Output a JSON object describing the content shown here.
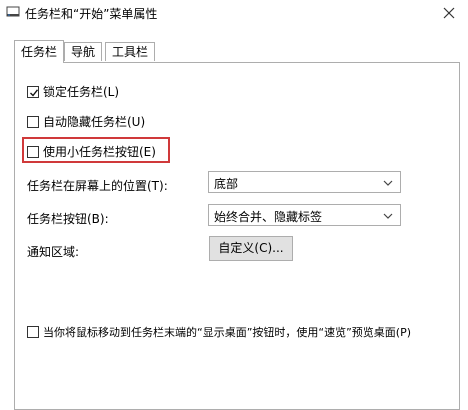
{
  "window": {
    "title": "任务栏和“开始”菜单属性",
    "app_icon": "taskbar-properties-icon",
    "close_icon": "close-icon"
  },
  "tabs": [
    {
      "label": "任务栏",
      "active": true
    },
    {
      "label": "导航",
      "active": false
    },
    {
      "label": "工具栏",
      "active": false
    }
  ],
  "taskbar": {
    "lock": {
      "label": "锁定任务栏(L)",
      "checked": true
    },
    "autohide": {
      "label": "自动隐藏任务栏(U)",
      "checked": false
    },
    "small_buttons": {
      "label": "使用小任务栏按钮(E)",
      "checked": false
    },
    "location": {
      "label": "任务栏在屏幕上的位置(T):",
      "value": "底部"
    },
    "buttons": {
      "label": "任务栏按钮(B):",
      "value": "始终合并、隐藏标签"
    },
    "notification": {
      "label": "通知区域:",
      "button_label": "自定义(C)..."
    },
    "peek": {
      "label": "当你将鼠标移动到任务栏末端的“显示桌面”按钮时，使用“速览”预览桌面(P)",
      "checked": false
    }
  },
  "colors": {
    "highlight_border": "#d0393a",
    "border": "#adadad",
    "button_bg": "#e1e1e1"
  }
}
